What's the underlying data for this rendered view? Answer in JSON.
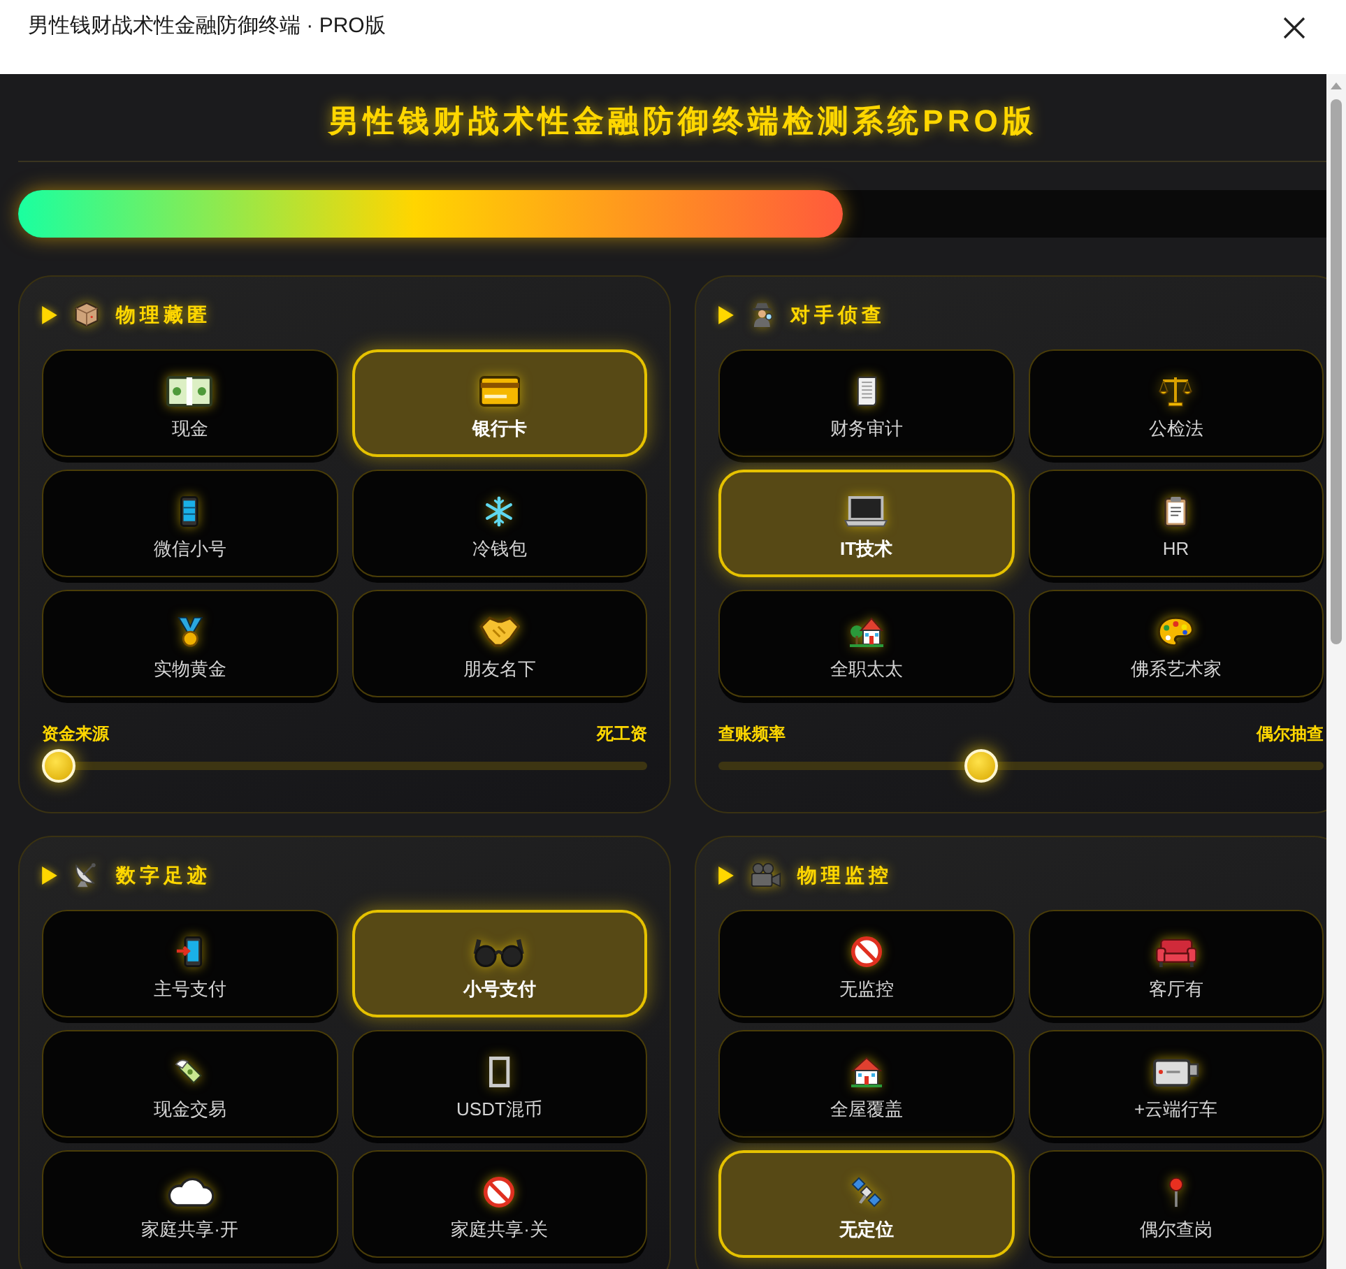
{
  "window": {
    "title": "男性钱财战术性金融防御终端 · PRO版"
  },
  "header": {
    "title": "男性钱财战术性金融防御终端检测系统PRO版"
  },
  "progress": {
    "level": 0.62
  },
  "sections": [
    {
      "title": "物理藏匿",
      "options": [
        {
          "label": "现金",
          "selected": false
        },
        {
          "label": "银行卡",
          "selected": true
        },
        {
          "label": "微信小号",
          "selected": false
        },
        {
          "label": "冷钱包",
          "selected": false
        },
        {
          "label": "实物黄金",
          "selected": false
        },
        {
          "label": "朋友名下",
          "selected": false
        }
      ],
      "slider": {
        "min_label": "资金来源",
        "max_label": "死工资",
        "level": 0
      }
    },
    {
      "title": "对手侦查",
      "options": [
        {
          "label": "财务审计",
          "selected": false
        },
        {
          "label": "公检法",
          "selected": false
        },
        {
          "label": "IT技术",
          "selected": true
        },
        {
          "label": "HR",
          "selected": false
        },
        {
          "label": "全职太太",
          "selected": false
        },
        {
          "label": "佛系艺术家",
          "selected": false
        }
      ],
      "slider": {
        "min_label": "查账频率",
        "max_label": "偶尔抽查",
        "level": 0.43
      }
    },
    {
      "title": "数字足迹",
      "options": [
        {
          "label": "主号支付",
          "selected": false
        },
        {
          "label": "小号支付",
          "selected": true
        },
        {
          "label": "现金交易",
          "selected": false
        },
        {
          "label": "USDT混币",
          "selected": false
        },
        {
          "label": "家庭共享·开",
          "selected": false
        },
        {
          "label": "家庭共享·关",
          "selected": false
        }
      ]
    },
    {
      "title": "物理监控",
      "options": [
        {
          "label": "无监控",
          "selected": false
        },
        {
          "label": "客厅有",
          "selected": false
        },
        {
          "label": "全屋覆盖",
          "selected": false
        },
        {
          "label": "+云端行车",
          "selected": false
        },
        {
          "label": "无定位",
          "selected": true
        },
        {
          "label": "偶尔查岗",
          "selected": false
        }
      ]
    }
  ]
}
